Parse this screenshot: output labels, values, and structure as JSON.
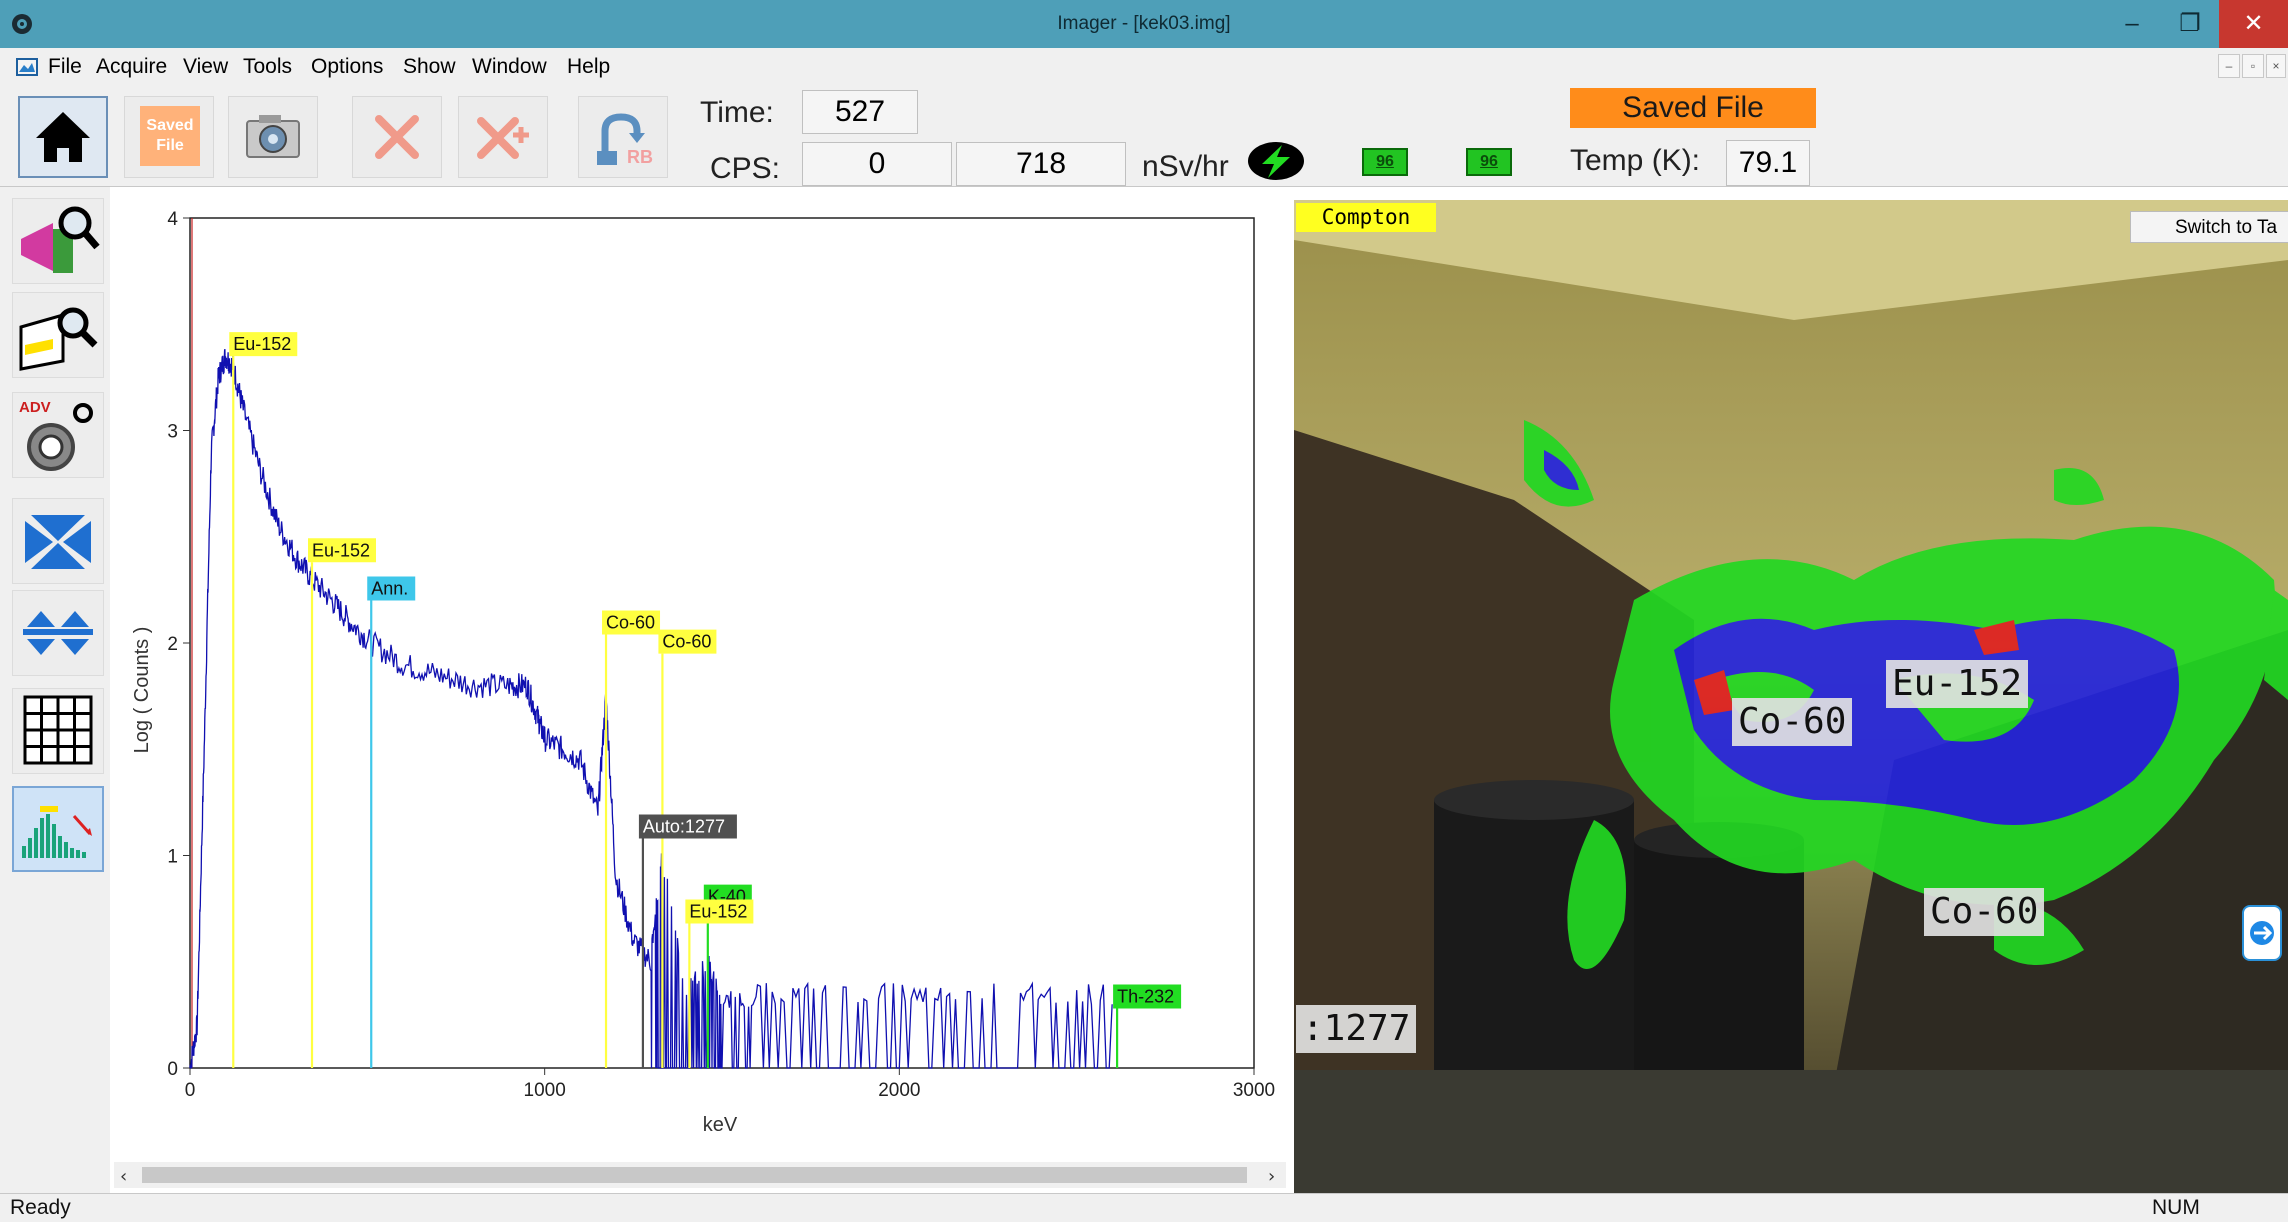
{
  "window": {
    "title": "Imager - [kek03.img]",
    "controls": [
      "–",
      "❐",
      "✕"
    ]
  },
  "menu": [
    "File",
    "Acquire",
    "View",
    "Tools",
    "Options",
    "Show",
    "Window",
    "Help"
  ],
  "toolbar": {
    "saved_file_button": "Saved File",
    "rb_label": "RB",
    "time_label": "Time:",
    "time_value": "527",
    "cps_label": "CPS:",
    "cps_value1": "0",
    "cps_value2": "718",
    "dose_unit": "nSv/hr",
    "battery1": "96",
    "battery2": "96",
    "saved_badge": "Saved File",
    "temp_label": "Temp (K):",
    "temp_value": "79.1"
  },
  "sidebar": {
    "adv_label": "ADV",
    "items": [
      "source-search",
      "region-search",
      "advanced-settings",
      "zoom-fit",
      "zoom-expand",
      "grid-view",
      "peak-id"
    ]
  },
  "spectrum": {
    "peak_labels": [
      {
        "text": "Eu-152",
        "color": "#ffff40"
      },
      {
        "text": "Eu-152",
        "color": "#ffff40"
      },
      {
        "text": "Ann.",
        "color": "#3ec7ea"
      },
      {
        "text": "Co-60",
        "color": "#ffff40"
      },
      {
        "text": "Co-60",
        "color": "#ffff40"
      },
      {
        "text": "Auto:1277",
        "color": "#505050"
      },
      {
        "text": "K-40",
        "color": "#22dd22"
      },
      {
        "text": "Eu-152",
        "color": "#ffff40"
      },
      {
        "text": "Th-232",
        "color": "#22dd22"
      }
    ]
  },
  "chart_data": {
    "type": "line",
    "title": "",
    "xlabel": "keV",
    "ylabel": "Log ( Counts )",
    "xlim": [
      0,
      3000
    ],
    "ylim": [
      0,
      4
    ],
    "x_ticks": [
      "0",
      "1000",
      "2000",
      "3000"
    ],
    "y_ticks": [
      "0",
      "1",
      "2",
      "3",
      "4"
    ],
    "grid": false,
    "series": [
      {
        "color": "#1010b0",
        "x": [
          0,
          20,
          40,
          60,
          80,
          100,
          122,
          150,
          200,
          250,
          300,
          344,
          400,
          450,
          511,
          600,
          700,
          800,
          900,
          950,
          980,
          1000,
          1050,
          1100,
          1150,
          1173,
          1200,
          1250,
          1300,
          1332,
          1400,
          1460,
          1500,
          1600,
          1800,
          2000,
          2200,
          2400,
          2600
        ],
        "y": [
          0,
          0.2,
          1.5,
          2.9,
          3.25,
          3.35,
          3.3,
          3.1,
          2.8,
          2.55,
          2.4,
          2.3,
          2.2,
          2.1,
          2.0,
          1.9,
          1.85,
          1.8,
          1.8,
          1.8,
          1.65,
          1.55,
          1.5,
          1.45,
          1.2,
          1.75,
          0.9,
          0.6,
          0.5,
          0.95,
          0.3,
          0.45,
          0.25,
          0.3,
          0.3,
          0.3,
          0.3,
          0.3,
          0.3
        ]
      }
    ],
    "markers": [
      {
        "label": "Eu-152",
        "x": 122,
        "y": 3.35,
        "color": "#ffff40"
      },
      {
        "label": "Eu-152",
        "x": 344,
        "y": 2.38,
        "color": "#ffff40"
      },
      {
        "label": "Ann.",
        "x": 511,
        "y": 2.2,
        "color": "#3ec7ea"
      },
      {
        "label": "Co-60",
        "x": 1173,
        "y": 2.04,
        "color": "#ffff40"
      },
      {
        "label": "Co-60",
        "x": 1332,
        "y": 1.95,
        "color": "#ffff40"
      },
      {
        "label": "Auto:1277",
        "x": 1277,
        "y": 1.08,
        "color": "#505050"
      },
      {
        "label": "K-40",
        "x": 1460,
        "y": 0.75,
        "color": "#22dd22"
      },
      {
        "label": "Eu-152",
        "x": 1408,
        "y": 0.68,
        "color": "#ffff40"
      },
      {
        "label": "Th-232",
        "x": 2614,
        "y": 0.28,
        "color": "#22dd22"
      }
    ]
  },
  "camera": {
    "mode_tag": "Compton",
    "switch_button": "Switch to Ta",
    "source_labels": [
      "Co-60",
      "Eu-152",
      "Co-60",
      ":1277"
    ]
  },
  "status": {
    "text": "Ready",
    "num": "NUM"
  }
}
